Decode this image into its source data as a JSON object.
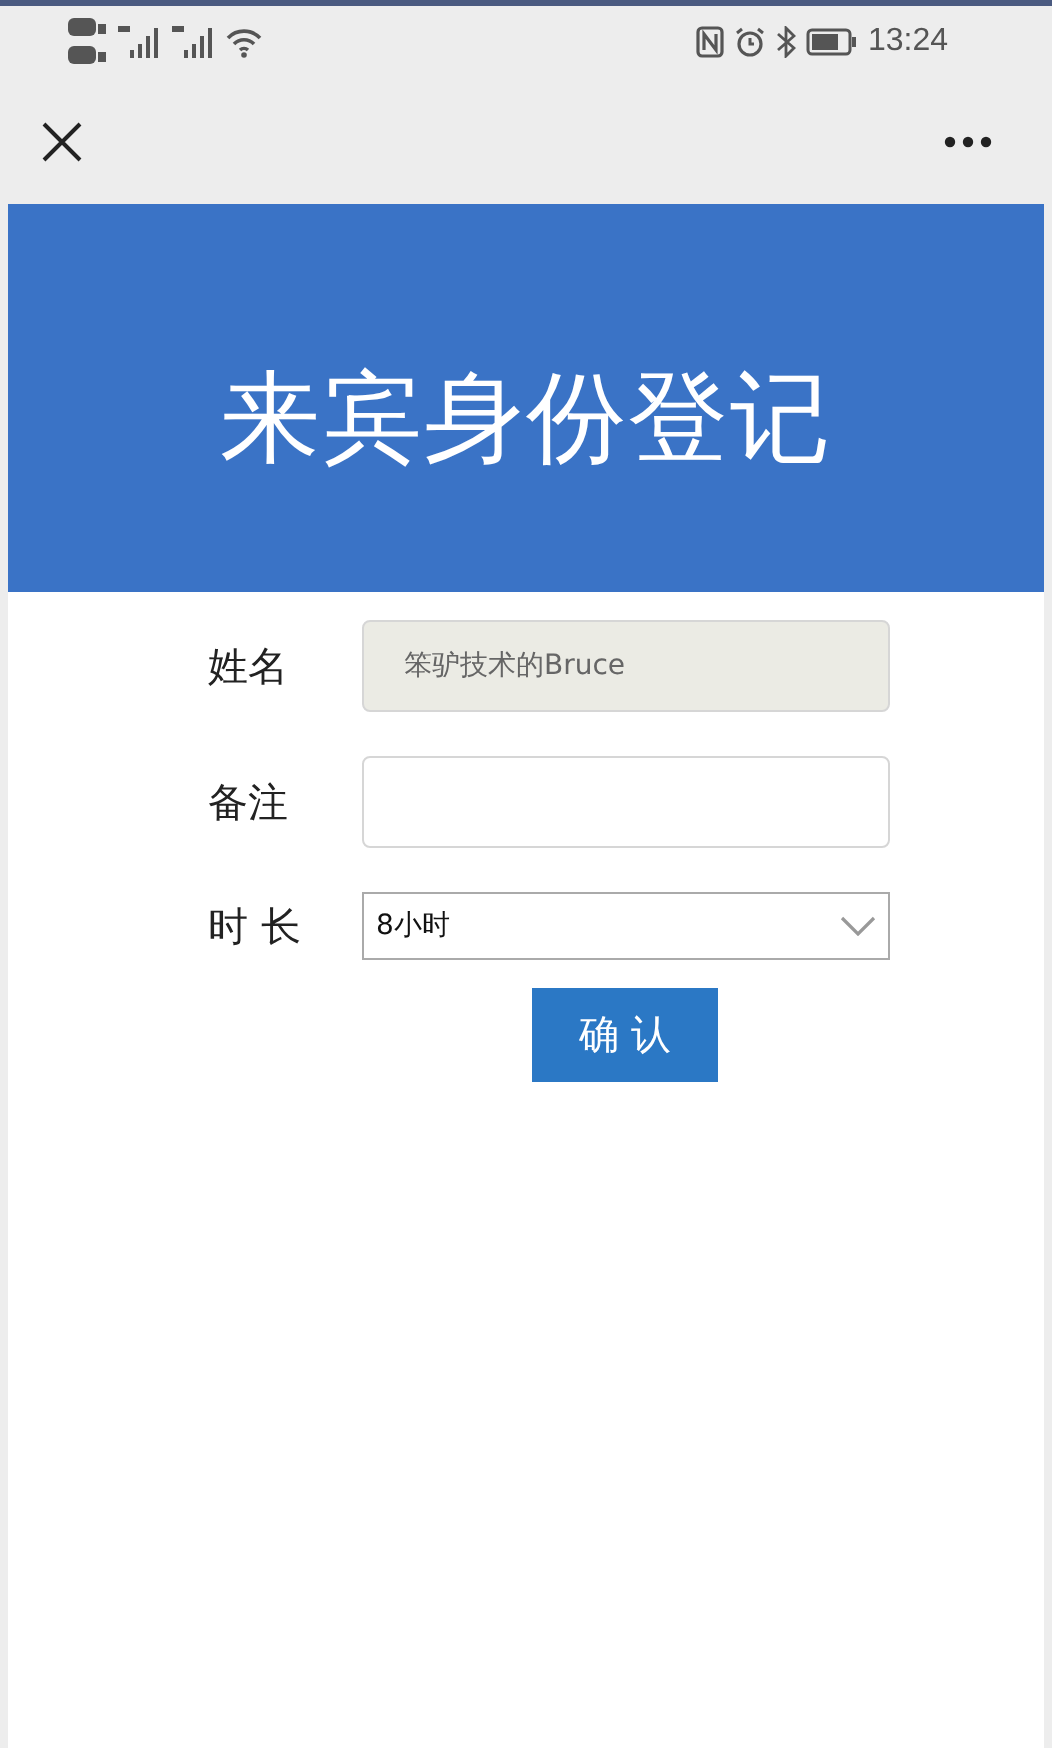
{
  "status_bar": {
    "time": "13:24"
  },
  "banner": {
    "title": "来宾身份登记"
  },
  "form": {
    "fields": [
      {
        "kind": "text",
        "label": "姓名",
        "value": "笨驴技术的Bruce",
        "disabled": true
      },
      {
        "kind": "text",
        "label": "备注",
        "disabled": false
      },
      {
        "kind": "select",
        "label": "时 长",
        "value": "8小时",
        "disabled": false
      }
    ],
    "submit": "确 认"
  }
}
